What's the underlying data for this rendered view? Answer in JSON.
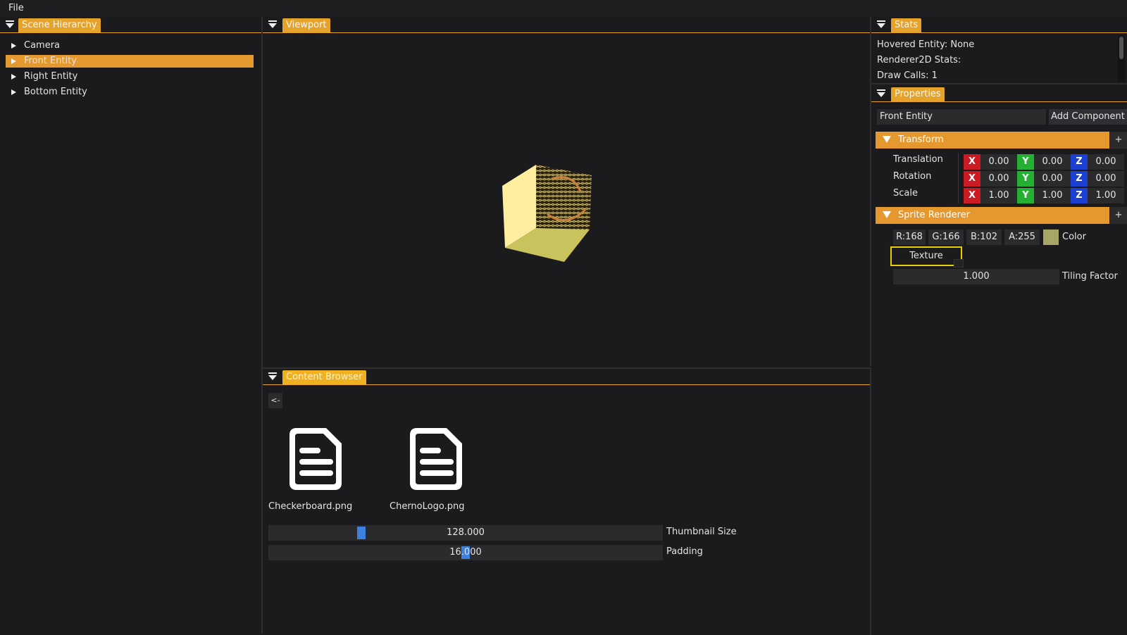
{
  "menubar": {
    "file_label": "File"
  },
  "scene_hierarchy": {
    "tab_label": "Scene Hierarchy",
    "items": [
      {
        "label": "Camera"
      },
      {
        "label": "Front Entity",
        "selected": true
      },
      {
        "label": "Right Entity"
      },
      {
        "label": "Bottom Entity"
      }
    ]
  },
  "viewport": {
    "tab_label": "Viewport"
  },
  "stats": {
    "tab_label": "Stats",
    "lines": [
      "Hovered Entity: None",
      "Renderer2D Stats:",
      "Draw Calls: 1"
    ]
  },
  "properties": {
    "tab_label": "Properties",
    "entity_name": "Front Entity",
    "add_component_label": "Add Component",
    "transform": {
      "header": "Transform",
      "plus": "+",
      "rows": [
        {
          "label": "Translation",
          "x": "0.00",
          "y": "0.00",
          "z": "0.00"
        },
        {
          "label": "Rotation",
          "x": "0.00",
          "y": "0.00",
          "z": "0.00"
        },
        {
          "label": "Scale",
          "x": "1.00",
          "y": "1.00",
          "z": "1.00"
        }
      ],
      "axis_x": "X",
      "axis_y": "Y",
      "axis_z": "Z"
    },
    "sprite_renderer": {
      "header": "Sprite Renderer",
      "plus": "+",
      "r": "R:168",
      "g": "G:166",
      "b": "B:102",
      "a": "A:255",
      "color_label": "Color",
      "swatch_color": "#a8a666",
      "texture_label": "Texture",
      "tiling_value": "1.000",
      "tiling_label": "Tiling Factor"
    }
  },
  "content_browser": {
    "tab_label": "Content Browser",
    "back_label": "<-",
    "files": [
      {
        "name": "Checkerboard.png",
        "icon": "file-icon"
      },
      {
        "name": "ChernoLogo.png",
        "icon": "file-icon"
      }
    ],
    "thumbnail_size": {
      "value": "128.000",
      "label": "Thumbnail Size"
    },
    "padding": {
      "value": "16.000",
      "label": "Padding"
    }
  },
  "colors": {
    "accent": "#e5a32b",
    "selected": "#e5982d",
    "slider_grab": "#3c80e0"
  }
}
